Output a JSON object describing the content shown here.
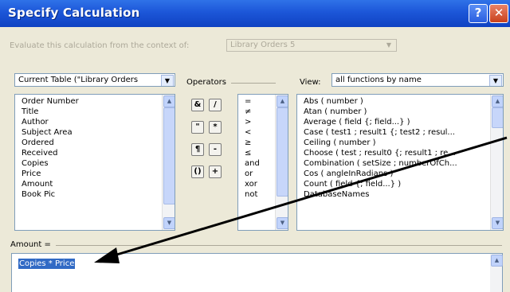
{
  "dialog": {
    "title": "Specify Calculation",
    "help_glyph": "?",
    "close_glyph": "✕"
  },
  "context": {
    "label": "Evaluate this calculation from the context of:",
    "value": "Library Orders 5"
  },
  "fields": {
    "table_select": "Current Table (\"Library Orders",
    "items": [
      "Order Number",
      "Title",
      "Author",
      "Subject Area",
      "Ordered",
      "Received",
      "Copies",
      "Price",
      "Amount",
      "Book Pic"
    ]
  },
  "operators": {
    "label": "Operators",
    "buttons": [
      "&",
      "/",
      "\"",
      "*",
      "¶",
      "-",
      "()",
      "+"
    ],
    "list": [
      "=",
      "≠",
      ">",
      "<",
      "≥",
      "≤",
      "and",
      "or",
      "xor",
      "not"
    ]
  },
  "view": {
    "label": "View:",
    "value": "all functions by name"
  },
  "functions": {
    "items": [
      "Abs ( number )",
      "Atan ( number )",
      "Average ( field {; field...} )",
      "Case ( test1 ; result1 {; test2 ; resul...",
      "Ceiling ( number )",
      "Choose ( test ; result0 {; result1 ; re...",
      "Combination ( setSize ; numberOfCh...",
      "Cos ( angleInRadians )",
      "Count ( field {; field...} )",
      "DatabaseNames"
    ]
  },
  "formula": {
    "label": "Amount =",
    "text": "Copies * Price"
  },
  "colors": {
    "titlebar": "#0f42c2",
    "selection": "#316ac5",
    "annotation_arrow": "#000000"
  }
}
